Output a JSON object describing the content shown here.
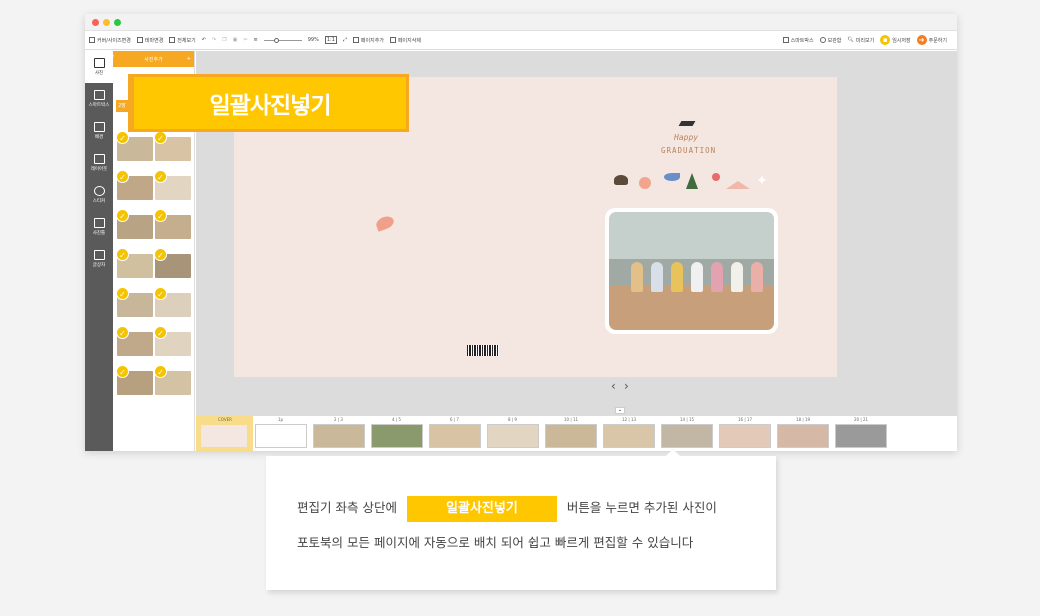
{
  "toolbar": {
    "left_items": [
      "커버/사이즈변경",
      "테마변경",
      "전체보기",
      "99%",
      "1:1",
      "페이지추가",
      "페이지삭제"
    ],
    "right_items": [
      "스마트박스",
      "보관함",
      "미리보기",
      "임시저장",
      "주문하기"
    ]
  },
  "sidebar": {
    "items": [
      {
        "label": "사진",
        "icon": "camera-icon"
      },
      {
        "label": "스마트박스",
        "icon": "box-icon"
      },
      {
        "label": "배경",
        "icon": "image-icon"
      },
      {
        "label": "레이아웃",
        "icon": "layout-icon"
      },
      {
        "label": "스티커",
        "icon": "sticker-icon"
      },
      {
        "label": "사진틀",
        "icon": "frame-icon"
      },
      {
        "label": "글상자",
        "icon": "text-icon"
      }
    ]
  },
  "panel": {
    "header": "사진추가",
    "plus": "+",
    "chip": "2장"
  },
  "callout": {
    "label": "일괄사진넣기"
  },
  "page": {
    "happy": "Happy",
    "graduation": "GRADUATION"
  },
  "nav": {
    "prev": "‹",
    "next": "›"
  },
  "filmstrip": {
    "cover": "COVER",
    "labels": [
      "1p",
      "2 | 3",
      "4 | 5",
      "6 | 7",
      "8 | 9",
      "10 | 11",
      "12 | 13",
      "14 | 15",
      "16 | 17",
      "18 | 19",
      "20 | 21"
    ]
  },
  "info": {
    "line1_prefix": "편집기 좌측 상단에",
    "badge": "일괄사진넣기",
    "line1_suffix": "버튼을 누르면 추가된 사진이",
    "line2": "포토북의 모든 페이지에 자동으로 배치 되어 쉽고 빠르게 편집할 수 있습니다"
  },
  "colors": {
    "accent": "#ffc700",
    "accent_dark": "#f7a823",
    "sidebar": "#5a5a5a",
    "page_bg": "#f4e6e0"
  }
}
